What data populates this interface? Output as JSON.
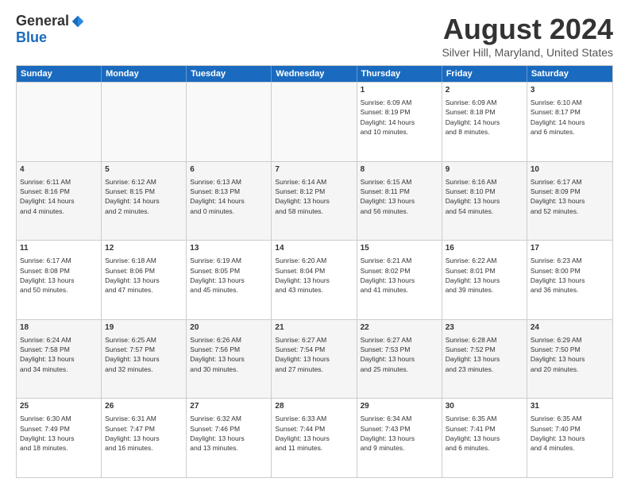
{
  "logo": {
    "general": "General",
    "blue": "Blue"
  },
  "title": "August 2024",
  "location": "Silver Hill, Maryland, United States",
  "days": [
    "Sunday",
    "Monday",
    "Tuesday",
    "Wednesday",
    "Thursday",
    "Friday",
    "Saturday"
  ],
  "weeks": [
    [
      {
        "day": "",
        "info": "",
        "empty": true
      },
      {
        "day": "",
        "info": "",
        "empty": true
      },
      {
        "day": "",
        "info": "",
        "empty": true
      },
      {
        "day": "",
        "info": "",
        "empty": true
      },
      {
        "day": "1",
        "info": "Sunrise: 6:09 AM\nSunset: 8:19 PM\nDaylight: 14 hours\nand 10 minutes.",
        "empty": false
      },
      {
        "day": "2",
        "info": "Sunrise: 6:09 AM\nSunset: 8:18 PM\nDaylight: 14 hours\nand 8 minutes.",
        "empty": false
      },
      {
        "day": "3",
        "info": "Sunrise: 6:10 AM\nSunset: 8:17 PM\nDaylight: 14 hours\nand 6 minutes.",
        "empty": false
      }
    ],
    [
      {
        "day": "4",
        "info": "Sunrise: 6:11 AM\nSunset: 8:16 PM\nDaylight: 14 hours\nand 4 minutes.",
        "empty": false
      },
      {
        "day": "5",
        "info": "Sunrise: 6:12 AM\nSunset: 8:15 PM\nDaylight: 14 hours\nand 2 minutes.",
        "empty": false
      },
      {
        "day": "6",
        "info": "Sunrise: 6:13 AM\nSunset: 8:13 PM\nDaylight: 14 hours\nand 0 minutes.",
        "empty": false
      },
      {
        "day": "7",
        "info": "Sunrise: 6:14 AM\nSunset: 8:12 PM\nDaylight: 13 hours\nand 58 minutes.",
        "empty": false
      },
      {
        "day": "8",
        "info": "Sunrise: 6:15 AM\nSunset: 8:11 PM\nDaylight: 13 hours\nand 56 minutes.",
        "empty": false
      },
      {
        "day": "9",
        "info": "Sunrise: 6:16 AM\nSunset: 8:10 PM\nDaylight: 13 hours\nand 54 minutes.",
        "empty": false
      },
      {
        "day": "10",
        "info": "Sunrise: 6:17 AM\nSunset: 8:09 PM\nDaylight: 13 hours\nand 52 minutes.",
        "empty": false
      }
    ],
    [
      {
        "day": "11",
        "info": "Sunrise: 6:17 AM\nSunset: 8:08 PM\nDaylight: 13 hours\nand 50 minutes.",
        "empty": false
      },
      {
        "day": "12",
        "info": "Sunrise: 6:18 AM\nSunset: 8:06 PM\nDaylight: 13 hours\nand 47 minutes.",
        "empty": false
      },
      {
        "day": "13",
        "info": "Sunrise: 6:19 AM\nSunset: 8:05 PM\nDaylight: 13 hours\nand 45 minutes.",
        "empty": false
      },
      {
        "day": "14",
        "info": "Sunrise: 6:20 AM\nSunset: 8:04 PM\nDaylight: 13 hours\nand 43 minutes.",
        "empty": false
      },
      {
        "day": "15",
        "info": "Sunrise: 6:21 AM\nSunset: 8:02 PM\nDaylight: 13 hours\nand 41 minutes.",
        "empty": false
      },
      {
        "day": "16",
        "info": "Sunrise: 6:22 AM\nSunset: 8:01 PM\nDaylight: 13 hours\nand 39 minutes.",
        "empty": false
      },
      {
        "day": "17",
        "info": "Sunrise: 6:23 AM\nSunset: 8:00 PM\nDaylight: 13 hours\nand 36 minutes.",
        "empty": false
      }
    ],
    [
      {
        "day": "18",
        "info": "Sunrise: 6:24 AM\nSunset: 7:58 PM\nDaylight: 13 hours\nand 34 minutes.",
        "empty": false
      },
      {
        "day": "19",
        "info": "Sunrise: 6:25 AM\nSunset: 7:57 PM\nDaylight: 13 hours\nand 32 minutes.",
        "empty": false
      },
      {
        "day": "20",
        "info": "Sunrise: 6:26 AM\nSunset: 7:56 PM\nDaylight: 13 hours\nand 30 minutes.",
        "empty": false
      },
      {
        "day": "21",
        "info": "Sunrise: 6:27 AM\nSunset: 7:54 PM\nDaylight: 13 hours\nand 27 minutes.",
        "empty": false
      },
      {
        "day": "22",
        "info": "Sunrise: 6:27 AM\nSunset: 7:53 PM\nDaylight: 13 hours\nand 25 minutes.",
        "empty": false
      },
      {
        "day": "23",
        "info": "Sunrise: 6:28 AM\nSunset: 7:52 PM\nDaylight: 13 hours\nand 23 minutes.",
        "empty": false
      },
      {
        "day": "24",
        "info": "Sunrise: 6:29 AM\nSunset: 7:50 PM\nDaylight: 13 hours\nand 20 minutes.",
        "empty": false
      }
    ],
    [
      {
        "day": "25",
        "info": "Sunrise: 6:30 AM\nSunset: 7:49 PM\nDaylight: 13 hours\nand 18 minutes.",
        "empty": false
      },
      {
        "day": "26",
        "info": "Sunrise: 6:31 AM\nSunset: 7:47 PM\nDaylight: 13 hours\nand 16 minutes.",
        "empty": false
      },
      {
        "day": "27",
        "info": "Sunrise: 6:32 AM\nSunset: 7:46 PM\nDaylight: 13 hours\nand 13 minutes.",
        "empty": false
      },
      {
        "day": "28",
        "info": "Sunrise: 6:33 AM\nSunset: 7:44 PM\nDaylight: 13 hours\nand 11 minutes.",
        "empty": false
      },
      {
        "day": "29",
        "info": "Sunrise: 6:34 AM\nSunset: 7:43 PM\nDaylight: 13 hours\nand 9 minutes.",
        "empty": false
      },
      {
        "day": "30",
        "info": "Sunrise: 6:35 AM\nSunset: 7:41 PM\nDaylight: 13 hours\nand 6 minutes.",
        "empty": false
      },
      {
        "day": "31",
        "info": "Sunrise: 6:35 AM\nSunset: 7:40 PM\nDaylight: 13 hours\nand 4 minutes.",
        "empty": false
      }
    ]
  ]
}
